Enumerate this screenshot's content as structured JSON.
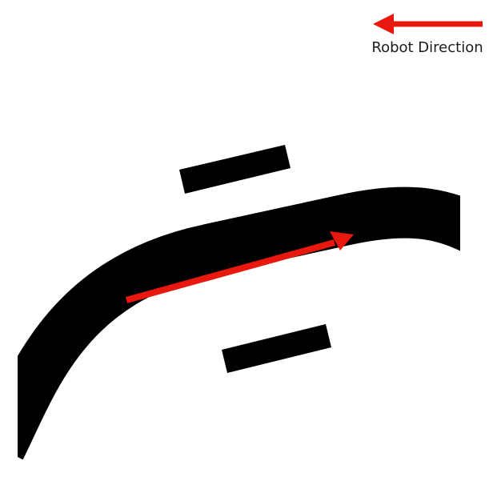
{
  "legend": {
    "label": "Robot Direction",
    "arrow_color": "#e8180f"
  },
  "track": {
    "color": "#000000"
  },
  "robot": {
    "arrow_color": "#e8180f"
  }
}
